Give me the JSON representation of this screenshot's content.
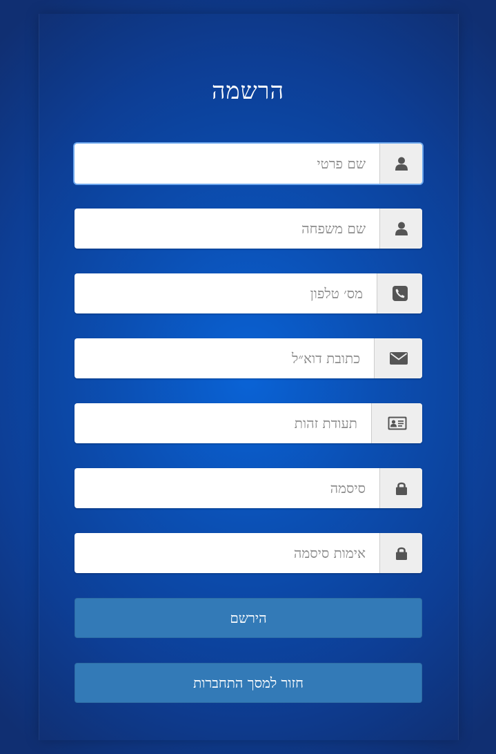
{
  "page": {
    "title": "הרשמה"
  },
  "fields": [
    {
      "name": "first-name",
      "placeholder": "שם פרטי",
      "icon": "user-icon"
    },
    {
      "name": "last-name",
      "placeholder": "שם משפחה",
      "icon": "user-icon"
    },
    {
      "name": "phone",
      "placeholder": "מס׳ טלפון",
      "icon": "phone-icon"
    },
    {
      "name": "email",
      "placeholder": "כתובת דוא״ל",
      "icon": "envelope-icon"
    },
    {
      "name": "id-number",
      "placeholder": "תעודת זהות",
      "icon": "id-card-icon"
    },
    {
      "name": "password",
      "placeholder": "סיסמה",
      "icon": "lock-icon"
    },
    {
      "name": "password-confirm",
      "placeholder": "אימות סיסמה",
      "icon": "lock-icon"
    }
  ],
  "buttons": {
    "register_label": "הירשם",
    "back_label": "חזור למסך התחברות"
  },
  "colors": {
    "background": "#0b4fb3",
    "button": "#337ab7",
    "addon": "#eeeeee",
    "icon": "#555555"
  }
}
